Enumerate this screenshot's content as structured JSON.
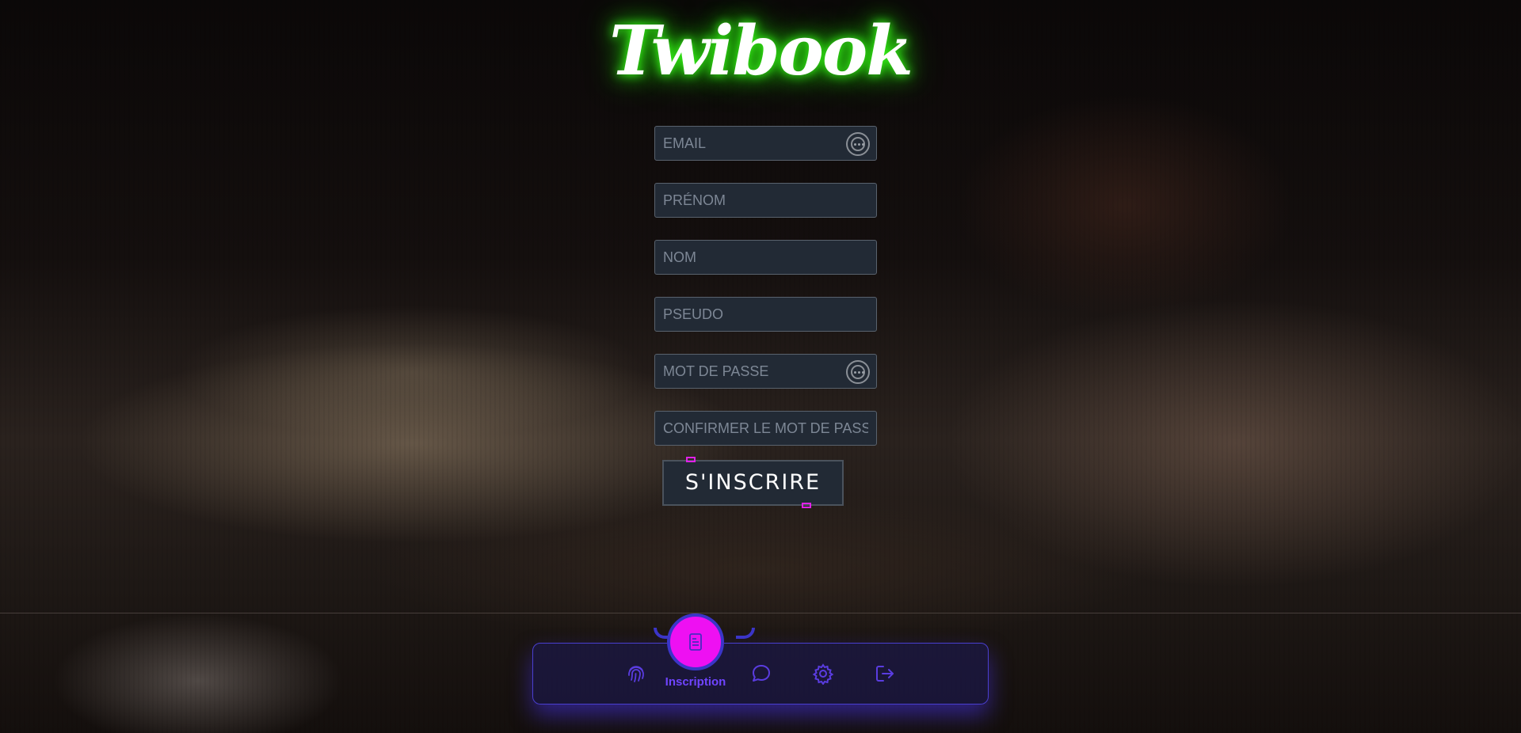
{
  "app": {
    "title": "Twibook"
  },
  "form": {
    "email_placeholder": "EMAIL",
    "firstname_placeholder": "PRÉNOM",
    "lastname_placeholder": "NOM",
    "pseudo_placeholder": "PSEUDO",
    "password_placeholder": "MOT DE PASSE",
    "confirm_placeholder": "CONFIRMER LE MOT DE PASSE",
    "submit_label": "S'INSCRIRE"
  },
  "nav": {
    "items": [
      {
        "icon": "fingerprint-icon",
        "label": ""
      },
      {
        "icon": "document-icon",
        "label": "Inscription",
        "active": true
      },
      {
        "icon": "chat-icon",
        "label": ""
      },
      {
        "icon": "gear-icon",
        "label": ""
      },
      {
        "icon": "logout-icon",
        "label": ""
      }
    ]
  },
  "colors": {
    "logo_glow": "#3aff1a",
    "accent_magenta": "#ee10f2",
    "accent_violet": "#6f44ff",
    "nav_border": "#4a3fd0",
    "field_bg": "#222a35"
  }
}
